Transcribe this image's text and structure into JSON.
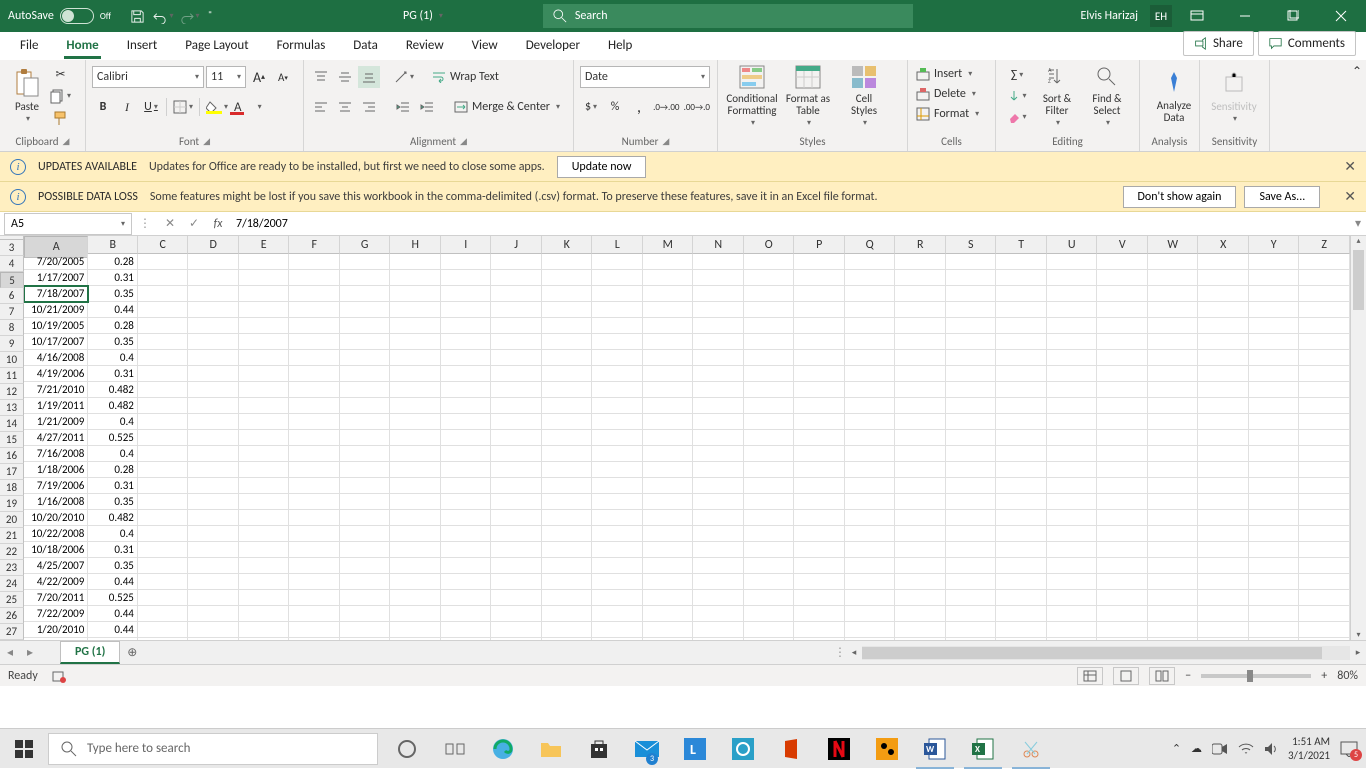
{
  "titlebar": {
    "autosave_label": "AutoSave",
    "autosave_state": "Off",
    "doc_name": "PG (1)",
    "search_placeholder": "Search",
    "user_name": "Elvis Harizaj",
    "user_initials": "EH"
  },
  "tabs": [
    "File",
    "Home",
    "Insert",
    "Page Layout",
    "Formulas",
    "Data",
    "Review",
    "View",
    "Developer",
    "Help"
  ],
  "active_tab": "Home",
  "share_label": "Share",
  "comments_label": "Comments",
  "ribbon": {
    "clipboard": {
      "paste": "Paste",
      "label": "Clipboard"
    },
    "font": {
      "name": "Calibri",
      "size": "11",
      "label": "Font"
    },
    "alignment": {
      "wrap": "Wrap Text",
      "merge": "Merge & Center",
      "label": "Alignment"
    },
    "number": {
      "format": "Date",
      "label": "Number"
    },
    "styles": {
      "cond": "Conditional\nFormatting",
      "tbl": "Format as\nTable",
      "cell": "Cell\nStyles",
      "label": "Styles"
    },
    "cells": {
      "insert": "Insert",
      "delete": "Delete",
      "format": "Format",
      "label": "Cells"
    },
    "editing": {
      "sort": "Sort &\nFilter",
      "find": "Find &\nSelect",
      "label": "Editing"
    },
    "analysis": {
      "analyze": "Analyze\nData",
      "label": "Analysis"
    },
    "sensitivity": {
      "sens": "Sensitivity",
      "label": "Sensitivity"
    }
  },
  "msg1": {
    "title": "UPDATES AVAILABLE",
    "text": "Updates for Office are ready to be installed, but first we need to close some apps.",
    "btn": "Update now"
  },
  "msg2": {
    "title": "POSSIBLE DATA LOSS",
    "text": "Some features might be lost if you save this workbook in the comma-delimited (.csv) format. To preserve these features, save it in an Excel file format.",
    "btn1": "Don't show again",
    "btn2": "Save As..."
  },
  "formula": {
    "cellref": "A5",
    "value": "7/18/2007"
  },
  "columns": [
    "A",
    "B",
    "C",
    "D",
    "E",
    "F",
    "G",
    "H",
    "I",
    "J",
    "K",
    "L",
    "M",
    "N",
    "O",
    "P",
    "Q",
    "R",
    "S",
    "T",
    "U",
    "V",
    "W",
    "X",
    "Y",
    "Z"
  ],
  "col_widths": {
    "A": 65,
    "B": 50,
    "default": 51
  },
  "first_row": 3,
  "active_row": 5,
  "rows": [
    {
      "n": 3,
      "A": "7/20/2005",
      "B": "0.28"
    },
    {
      "n": 4,
      "A": "1/17/2007",
      "B": "0.31"
    },
    {
      "n": 5,
      "A": "7/18/2007",
      "B": "0.35"
    },
    {
      "n": 6,
      "A": "10/21/2009",
      "B": "0.44"
    },
    {
      "n": 7,
      "A": "10/19/2005",
      "B": "0.28"
    },
    {
      "n": 8,
      "A": "10/17/2007",
      "B": "0.35"
    },
    {
      "n": 9,
      "A": "4/16/2008",
      "B": "0.4"
    },
    {
      "n": 10,
      "A": "4/19/2006",
      "B": "0.31"
    },
    {
      "n": 11,
      "A": "7/21/2010",
      "B": "0.482"
    },
    {
      "n": 12,
      "A": "1/19/2011",
      "B": "0.482"
    },
    {
      "n": 13,
      "A": "1/21/2009",
      "B": "0.4"
    },
    {
      "n": 14,
      "A": "4/27/2011",
      "B": "0.525"
    },
    {
      "n": 15,
      "A": "7/16/2008",
      "B": "0.4"
    },
    {
      "n": 16,
      "A": "1/18/2006",
      "B": "0.28"
    },
    {
      "n": 17,
      "A": "7/19/2006",
      "B": "0.31"
    },
    {
      "n": 18,
      "A": "1/16/2008",
      "B": "0.35"
    },
    {
      "n": 19,
      "A": "10/20/2010",
      "B": "0.482"
    },
    {
      "n": 20,
      "A": "10/22/2008",
      "B": "0.4"
    },
    {
      "n": 21,
      "A": "10/18/2006",
      "B": "0.31"
    },
    {
      "n": 22,
      "A": "4/25/2007",
      "B": "0.35"
    },
    {
      "n": 23,
      "A": "4/22/2009",
      "B": "0.44"
    },
    {
      "n": 24,
      "A": "7/20/2011",
      "B": "0.525"
    },
    {
      "n": 25,
      "A": "7/22/2009",
      "B": "0.44"
    },
    {
      "n": 26,
      "A": "1/20/2010",
      "B": "0.44"
    },
    {
      "n": 27,
      "A": "",
      "B": ""
    }
  ],
  "sheet_tab": "PG (1)",
  "status": {
    "ready": "Ready",
    "zoom": "80%"
  },
  "taskbar": {
    "search_placeholder": "Type here to search",
    "time": "1:51 AM",
    "date": "3/1/2021",
    "mail_badge": "3",
    "notif_badge": "5"
  }
}
